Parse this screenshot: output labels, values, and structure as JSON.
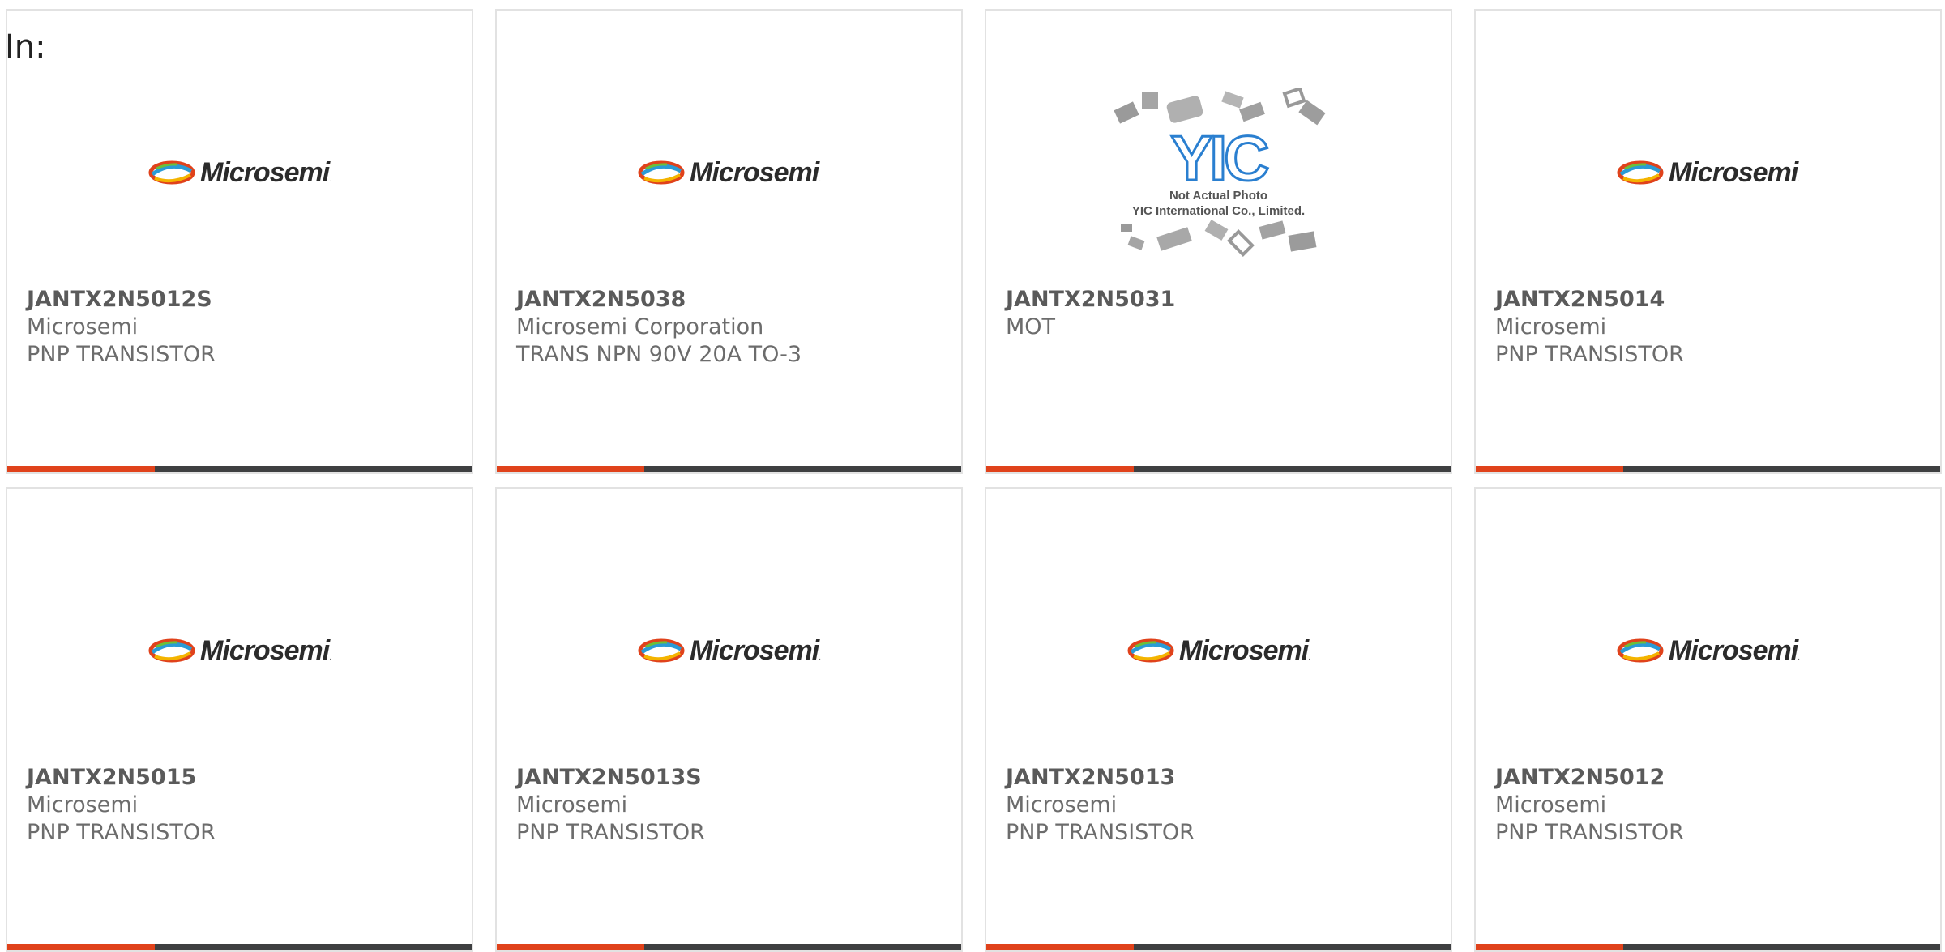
{
  "header": {
    "label": "In:"
  },
  "colors": {
    "accent": "#e0421b",
    "bar_dark": "#3e3f41",
    "text_gray": "#6c6c6c"
  },
  "products": [
    {
      "part_number": "JANTX2N5012S",
      "manufacturer": "Microsemi",
      "description": "PNP TRANSISTOR",
      "image": "microsemi-logo"
    },
    {
      "part_number": "JANTX2N5038",
      "manufacturer": "Microsemi Corporation",
      "description": "TRANS NPN 90V 20A TO-3",
      "image": "microsemi-logo"
    },
    {
      "part_number": "JANTX2N5031",
      "manufacturer": "MOT",
      "description": "",
      "image": "yic-placeholder",
      "placeholder_mark": "YIC",
      "placeholder_line1": "Not Actual Photo",
      "placeholder_line2": "YIC International Co., Limited."
    },
    {
      "part_number": "JANTX2N5014",
      "manufacturer": "Microsemi",
      "description": "PNP TRANSISTOR",
      "image": "microsemi-logo"
    },
    {
      "part_number": "JANTX2N5015",
      "manufacturer": "Microsemi",
      "description": "PNP TRANSISTOR",
      "image": "microsemi-logo"
    },
    {
      "part_number": "JANTX2N5013S",
      "manufacturer": "Microsemi",
      "description": "PNP TRANSISTOR",
      "image": "microsemi-logo"
    },
    {
      "part_number": "JANTX2N5013",
      "manufacturer": "Microsemi",
      "description": "PNP TRANSISTOR",
      "image": "microsemi-logo"
    },
    {
      "part_number": "JANTX2N5012",
      "manufacturer": "Microsemi",
      "description": "PNP TRANSISTOR",
      "image": "microsemi-logo"
    }
  ],
  "logo": {
    "wordmark": "Microsemi"
  }
}
